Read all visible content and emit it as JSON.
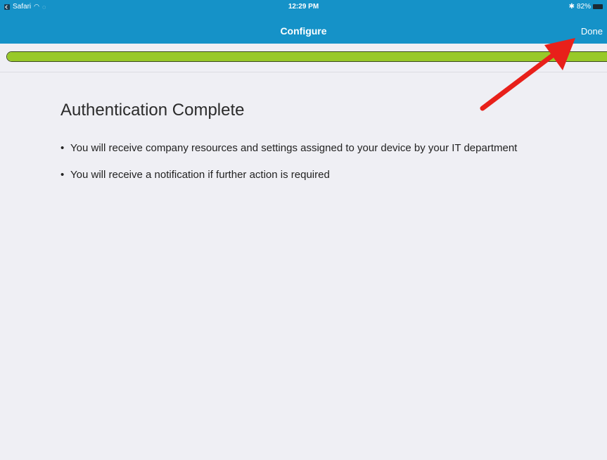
{
  "status_bar": {
    "app_label": "Safari",
    "time": "12:29 PM",
    "battery": "82%"
  },
  "nav_bar": {
    "title": "Configure",
    "done_label": "Done"
  },
  "progress": {
    "value": 1.0,
    "fill_color": "#98c929",
    "track_border_color": "#3b4a1d"
  },
  "content": {
    "title": "Authentication Complete",
    "bullets": [
      "You will receive company resources and settings assigned to your device by your IT department",
      "You will receive a notification if further action is required"
    ]
  },
  "colors": {
    "nav_background": "#1592c8",
    "page_background": "#efeff4",
    "annotation_arrow": "#e8201a"
  },
  "icons": {
    "back_to_app": "back-to-app-icon",
    "wifi": "wifi-icon",
    "activity": "signal-icon",
    "bluetooth": "bluetooth-icon",
    "battery": "battery-icon",
    "annotation": "red-arrow-icon"
  }
}
